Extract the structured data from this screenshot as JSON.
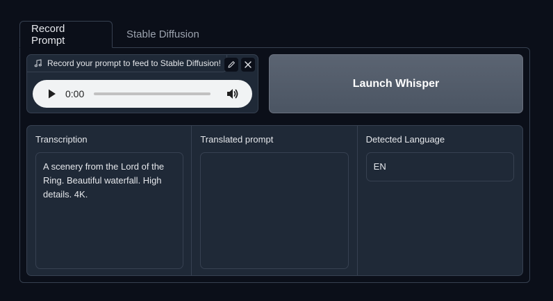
{
  "tabs": [
    {
      "label": "Record Prompt",
      "active": true
    },
    {
      "label": "Stable Diffusion",
      "active": false
    }
  ],
  "audio": {
    "label": "Record your prompt to feed to Stable Diffusion!",
    "time": "0:00",
    "icons": {
      "label": "music-note-icon",
      "edit": "pencil-icon",
      "close": "close-icon",
      "play": "play-icon",
      "volume": "volume-icon"
    }
  },
  "launch_button": {
    "label": "Launch Whisper"
  },
  "outputs": {
    "transcription": {
      "label": "Transcription",
      "value": "A scenery from the Lord of the Ring. Beautiful waterfall. High details. 4K."
    },
    "translated": {
      "label": "Translated prompt",
      "value": ""
    },
    "language": {
      "label": "Detected Language",
      "value": "EN"
    }
  },
  "colors": {
    "background": "#0b0f19",
    "block": "#1f2937",
    "border": "#374151",
    "button": "#4b5563"
  }
}
